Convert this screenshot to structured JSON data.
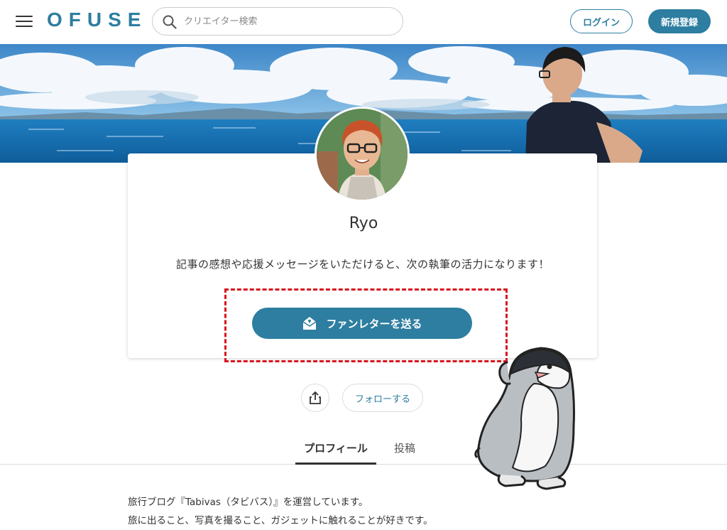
{
  "header": {
    "logo": "OFUSE",
    "search_placeholder": "クリエイター検索",
    "login_label": "ログイン",
    "register_label": "新規登録"
  },
  "profile": {
    "name": "Ryo",
    "message": "記事の感想や応援メッセージをいただけると、次の執筆の活力になります！",
    "fanletter_label": "ファンレターを送る",
    "follow_label": "フォローする"
  },
  "tabs": [
    {
      "label": "プロフィール",
      "active": true
    },
    {
      "label": "投稿",
      "active": false
    }
  ],
  "profile_text": {
    "line1": "旅行ブログ『Tabivas（タビバス）』を運営しています。",
    "line2": "旅に出ること、写真を撮ること、ガジェットに触れることが好きです。"
  },
  "colors": {
    "accent": "#2d7ea0",
    "highlight": "#d8161e"
  },
  "icons": {
    "menu": "menu-icon",
    "search": "search-icon",
    "envelope": "envelope-heart-icon",
    "share": "share-icon"
  }
}
